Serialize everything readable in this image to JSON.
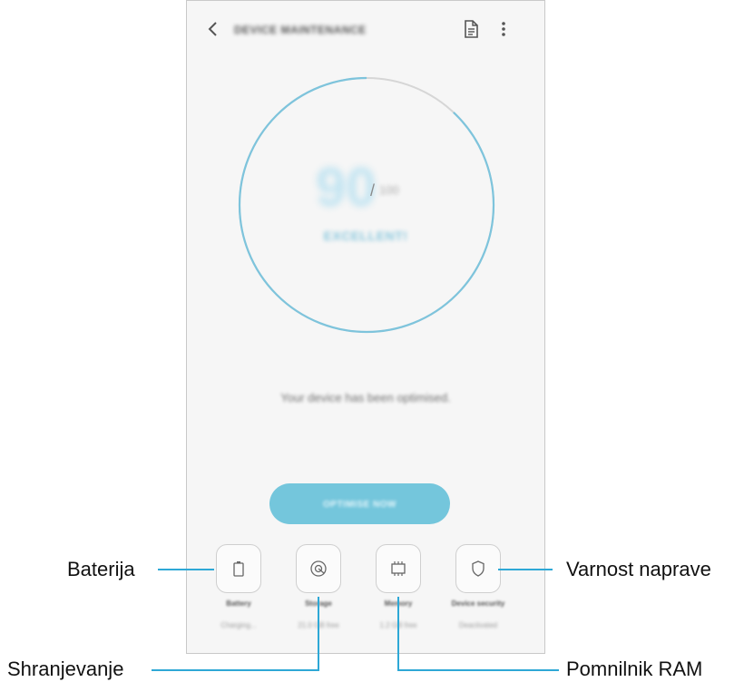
{
  "appbar": {
    "title": "DEVICE MAINTENANCE",
    "back_icon": "chevron-left-icon",
    "report_icon": "document-icon",
    "more_icon": "more-vertical-icon"
  },
  "score": {
    "value": "90",
    "slash": "/",
    "max": "100",
    "status": "EXCELLENT!",
    "ring_fraction": 0.88
  },
  "message": "Your device has been optimised.",
  "optimise_button": "OPTIMISE NOW",
  "tiles": [
    {
      "label": "Battery",
      "sub": "Charging...",
      "icon": "battery-icon"
    },
    {
      "label": "Storage",
      "sub": "21.0 GB free",
      "icon": "storage-icon"
    },
    {
      "label": "Memory",
      "sub": "1.2 GB free",
      "icon": "memory-chip-icon"
    },
    {
      "label": "Device security",
      "sub": "Deactivated",
      "icon": "shield-icon"
    }
  ],
  "callouts": {
    "battery": "Baterija",
    "storage": "Shranjevanje",
    "security": "Varnost naprave",
    "memory": "Pomnilnik RAM"
  },
  "colors": {
    "accent": "#74c6dc",
    "ring": "#7ec4dc",
    "callout_line": "#2ea8d6"
  }
}
